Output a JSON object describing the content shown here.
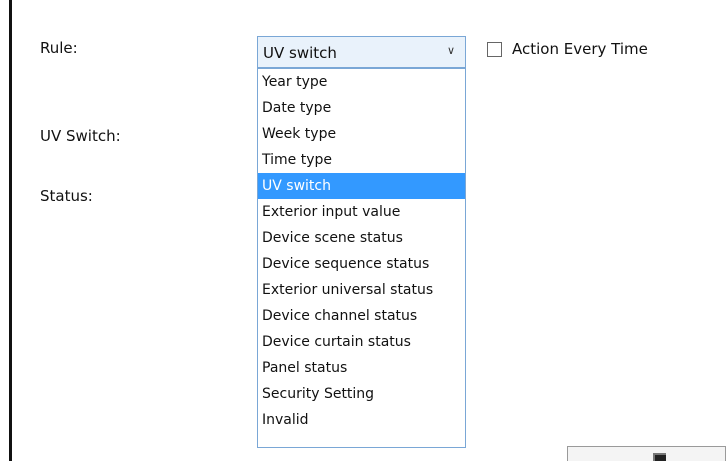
{
  "labels": {
    "rule": "Rule:",
    "uv_switch": "UV Switch:",
    "status": "Status:"
  },
  "rule_select": {
    "selected": "UV switch",
    "arrow_icon": "chevron-down-icon"
  },
  "action_every_time": {
    "label": "Action Every Time",
    "checked": false
  },
  "dropdown": {
    "options": [
      "Year type",
      "Date type",
      "Week type",
      "Time type",
      "UV switch",
      "Exterior input value",
      "Device scene status",
      "Device sequence status",
      "Exterior universal status",
      "Device channel status",
      "Device curtain status",
      "Panel status",
      "Security Setting",
      "Invalid"
    ],
    "selected_index": 4
  },
  "colors": {
    "selection": "#3399ff",
    "combo_border": "#7aa7d6"
  }
}
